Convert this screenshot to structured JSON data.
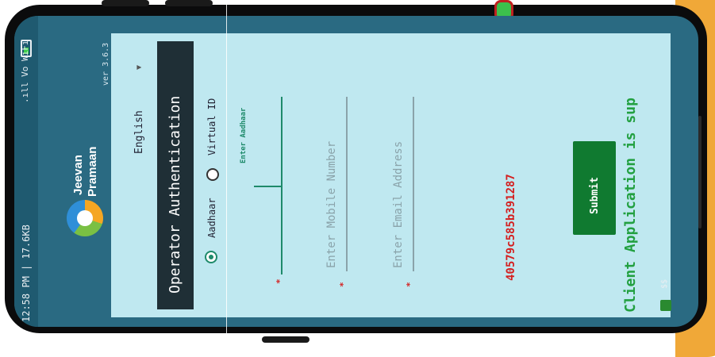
{
  "status_bar": {
    "time_data": "12:58 PM | 17.6KB",
    "network": ".ıll Vo WiFi"
  },
  "header": {
    "brand_line1": "Jeevan",
    "brand_line2": "Pramaan",
    "version": "ver 3.6.3"
  },
  "form": {
    "title": "Operator Authentication",
    "language": "English",
    "radio_options": [
      {
        "label": "Aadhaar",
        "selected": true
      },
      {
        "label": "Virtual ID",
        "selected": false
      }
    ],
    "aadhaar_field": {
      "floating_label": "Enter Aadhaar",
      "value": ""
    },
    "mobile_field": {
      "placeholder": "Enter Mobile Number"
    },
    "email_field": {
      "placeholder": "Enter Email Address"
    },
    "required_marker": "*",
    "device_token": "40579c585b391287",
    "submit_label": "Submit",
    "marquee": "Client Application is sup"
  },
  "bottom_bar": {
    "text": "$$"
  },
  "colors": {
    "header_bg": "#2a6a82",
    "panel_bg": "#bfe8f0",
    "title_bg": "#1f2f36",
    "accent_green": "#1e8a6a",
    "submit_bg": "#107a30",
    "token_red": "#d42020",
    "marquee_green": "#22a040"
  }
}
